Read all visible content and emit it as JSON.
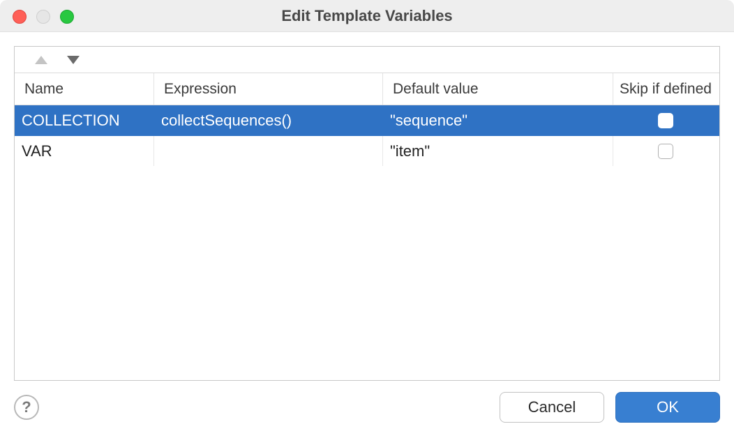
{
  "window": {
    "title": "Edit Template Variables"
  },
  "toolbar": {
    "move_up": "▲",
    "move_down": "▼"
  },
  "table": {
    "headers": {
      "name": "Name",
      "expression": "Expression",
      "default": "Default value",
      "skip": "Skip if defined"
    },
    "rows": [
      {
        "name": "COLLECTION",
        "expression": "collectSequences()",
        "default": "\"sequence\"",
        "skip": false,
        "selected": true
      },
      {
        "name": "VAR",
        "expression": "",
        "default": "\"item\"",
        "skip": false,
        "selected": false
      }
    ]
  },
  "footer": {
    "help": "?",
    "cancel": "Cancel",
    "ok": "OK"
  }
}
